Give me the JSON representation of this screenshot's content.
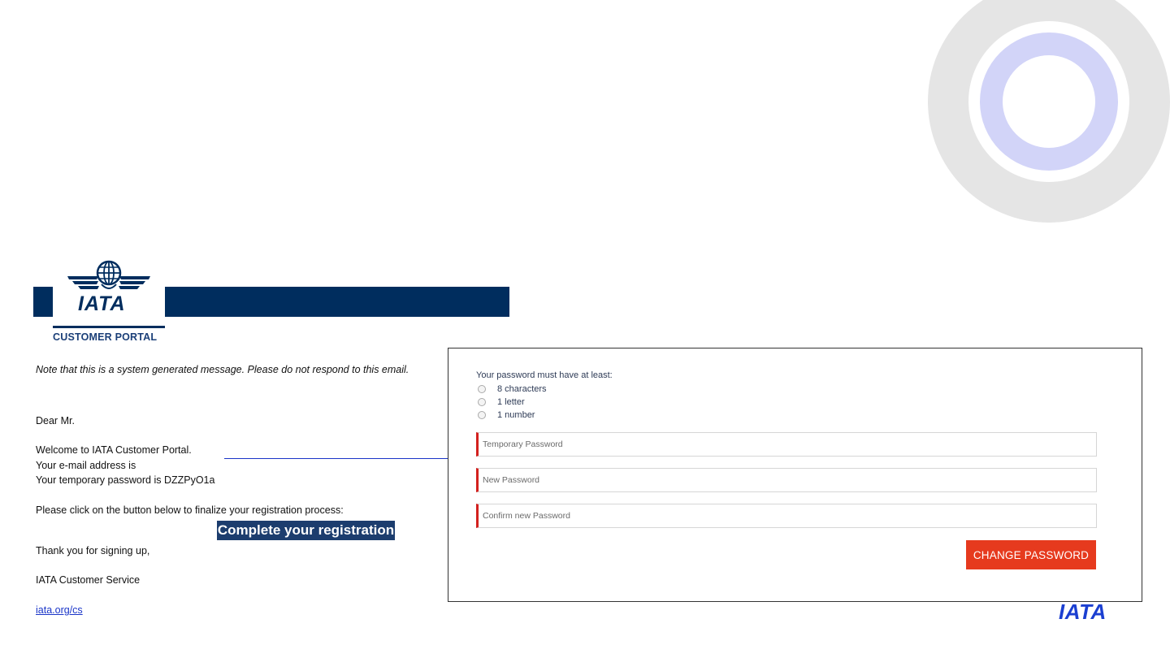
{
  "header": {
    "logo_text": "IATA",
    "portal_label": "CUSTOMER PORTAL"
  },
  "email": {
    "notice": "Note that this is a system generated message. Please do not respond to this email.",
    "greeting": "Dear Mr.",
    "welcome": "Welcome to IATA Customer Portal.",
    "email_line": "Your e-mail address is",
    "password_line": "Your temporary password is DZZPyO1a",
    "instruction": "Please click on the button below to finalize your registration process:",
    "cta_label": "Complete your registration",
    "thanks": "Thank you for signing up,",
    "signature": "IATA Customer Service",
    "link": "iata.org/cs"
  },
  "form": {
    "requirements_title": "Your password must have at least:",
    "requirements": [
      "8 characters",
      "1 letter",
      "1 number"
    ],
    "temporary_password_placeholder": "Temporary Password",
    "new_password_placeholder": "New Password",
    "confirm_password_placeholder": "Confirm new Password",
    "submit_label": "CHANGE PASSWORD"
  },
  "footer": {
    "logo_text": "IATA"
  },
  "colors": {
    "navy": "#002d5e",
    "accent_red": "#e63a1e",
    "link_blue": "#1a35c8"
  }
}
